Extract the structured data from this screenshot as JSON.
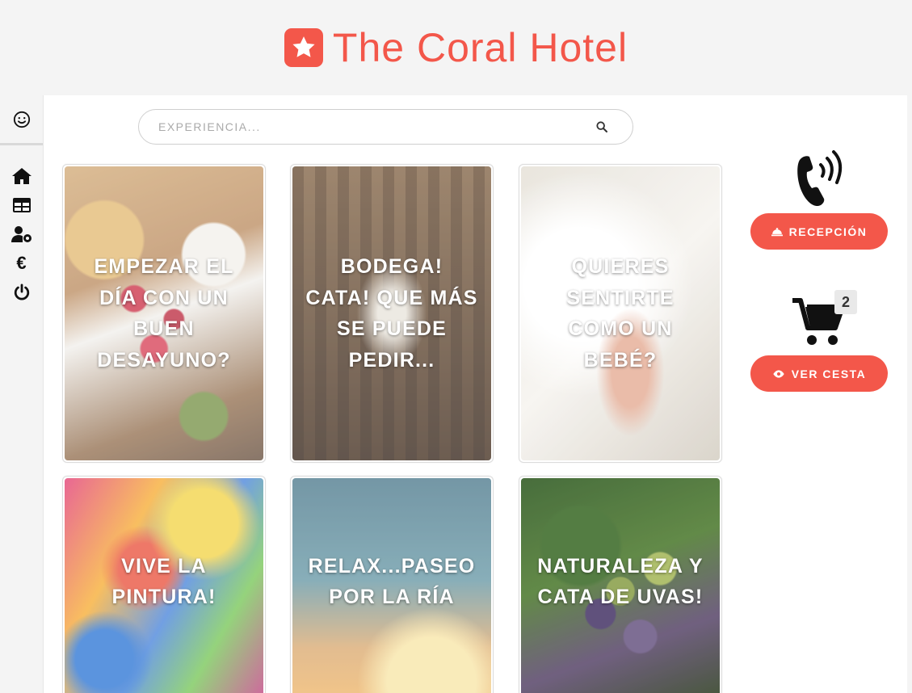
{
  "brand": {
    "title": "The Coral Hotel",
    "logo_icon": "star-square-icon",
    "color": "#f3574a"
  },
  "sidebar": {
    "top_icon": "smiley-icon",
    "items": [
      {
        "name": "home",
        "icon": "home-icon"
      },
      {
        "name": "table",
        "icon": "table-icon"
      },
      {
        "name": "user-settings",
        "icon": "user-cog-icon"
      },
      {
        "name": "euro",
        "icon": "euro-icon"
      },
      {
        "name": "power",
        "icon": "power-icon"
      }
    ]
  },
  "search": {
    "placeholder": "Experiencia...",
    "value": "",
    "icon": "search-icon"
  },
  "cards": [
    {
      "title": "Empezar el día con un buen desayuno?"
    },
    {
      "title": "Bodega! Cata! Que más se puede pedir..."
    },
    {
      "title": "Quieres sentirte como un bebé?"
    },
    {
      "title": "Vive la pintura!"
    },
    {
      "title": "Relax...paseo por la ría"
    },
    {
      "title": "Naturaleza y cata de uvas!"
    }
  ],
  "actions": {
    "reception_label": "Recepción",
    "reception_icon": "bell-icon",
    "phone_icon": "phone-volume-icon",
    "cart_icon": "shopping-cart-icon",
    "cart_count": "2",
    "view_cart_label": "Ver cesta",
    "view_cart_icon": "eye-icon"
  },
  "colors": {
    "accent": "#f3574a",
    "page_bg": "#f4f4f4",
    "panel_bg": "#ffffff"
  }
}
